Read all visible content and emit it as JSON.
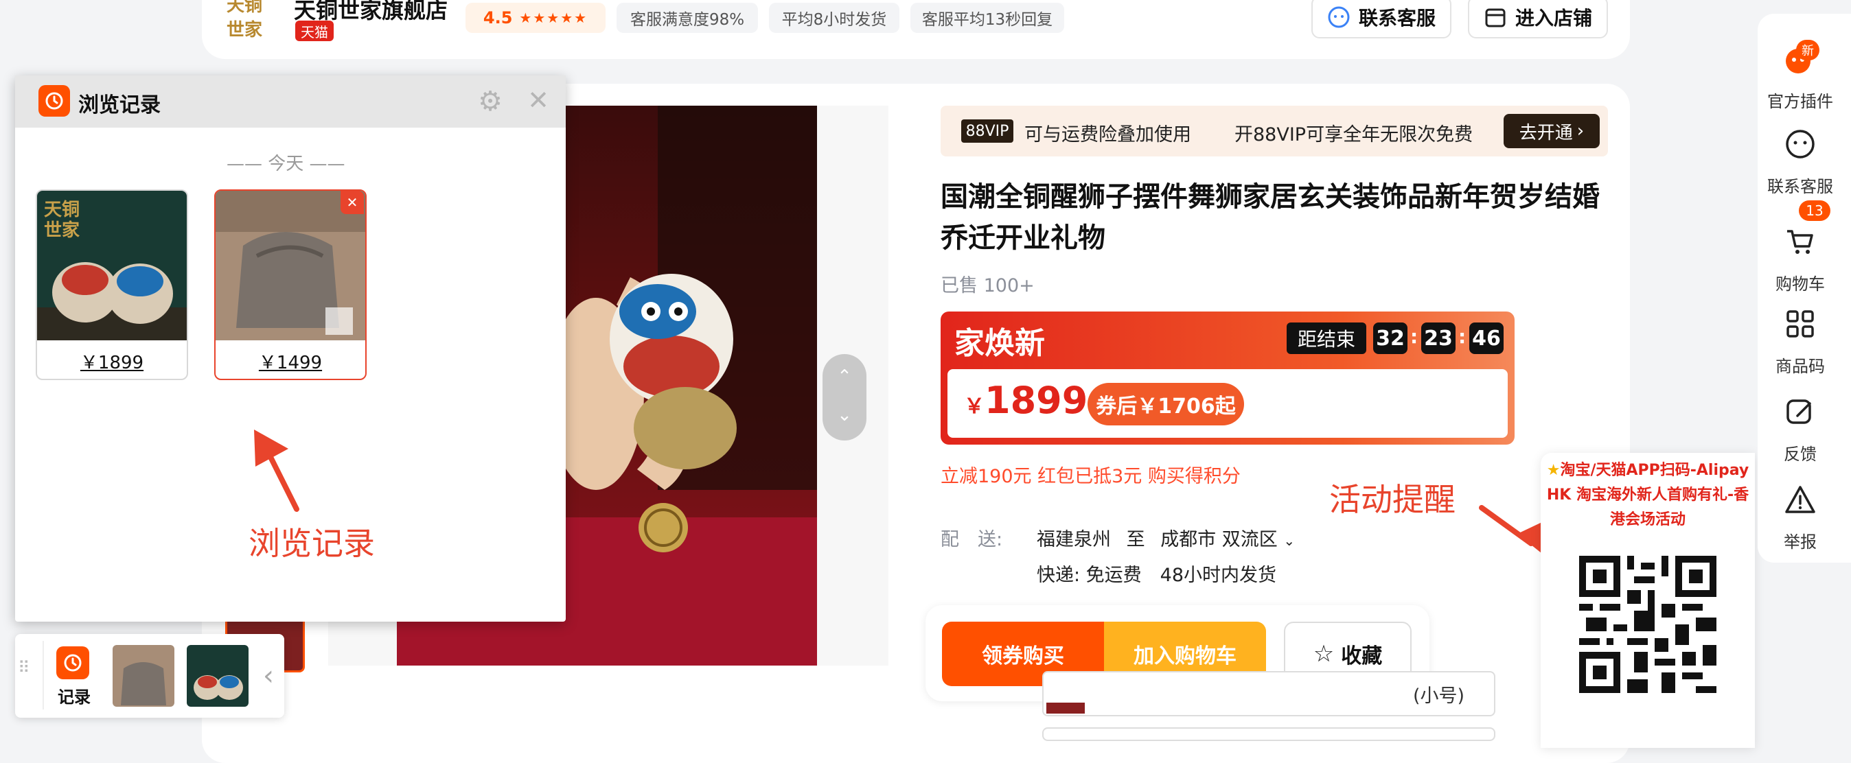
{
  "store": {
    "name": "天铜世家旗舰店",
    "badge": "天猫",
    "rating": "4.5",
    "metrics": [
      "客服满意度98%",
      "平均8小时发货",
      "客服平均13秒回复"
    ],
    "contact_label": "联系客服",
    "enter_label": "进入店铺"
  },
  "history_panel": {
    "title": "浏览记录",
    "section_label": "—— 今天 ——",
    "items": [
      {
        "price": "￥1899"
      },
      {
        "price": "￥1499"
      }
    ],
    "annotation": "浏览记录"
  },
  "history_bar": {
    "label": "记录"
  },
  "vip_banner": {
    "badge": "88VIP",
    "text1": "可与运费险叠加使用",
    "text2": "开88VIP可享全年无限次免费",
    "cta": "去开通"
  },
  "product": {
    "title_line1": "国潮全铜醒狮子摆件舞狮家居玄关装饰品新年贺岁结婚",
    "title_line2": "乔迁开业礼物",
    "sold": "已售 100+"
  },
  "promo": {
    "title": "家焕新",
    "countdown_label": "距结束",
    "hours": "32",
    "minutes": "23",
    "seconds": "46",
    "price_symbol": "￥",
    "price": "1899",
    "price_suffix": "起",
    "coupon_label": "券后￥1706起",
    "discount_text": "立减190元 红包已抵3元 购买得积分"
  },
  "shipping": {
    "label": "配　送:",
    "from": "福建泉州",
    "to_word": "至",
    "dest": "成都市 双流区",
    "express": "快递: 免运费　48小时内发货"
  },
  "actions": {
    "coupon_buy": "领券购买",
    "add_cart": "加入购物车",
    "favorite": "收藏"
  },
  "variant_peek": "(小号)",
  "right_sidebar": {
    "items": [
      {
        "label": "官方插件",
        "badge": "新"
      },
      {
        "label": "联系客服"
      },
      {
        "label": "购物车",
        "badge": "13"
      },
      {
        "label": "商品码"
      },
      {
        "label": "反馈"
      },
      {
        "label": "举报"
      }
    ]
  },
  "activity": {
    "annotation": "活动提醒",
    "text": "淘宝/天猫APP扫码-AlipayHK 淘宝海外新人首购有礼-香港会场活动"
  },
  "colors": {
    "brand_orange": "#ff5000",
    "promo_red": "#e1251b",
    "annotation_red": "#e8442c"
  }
}
